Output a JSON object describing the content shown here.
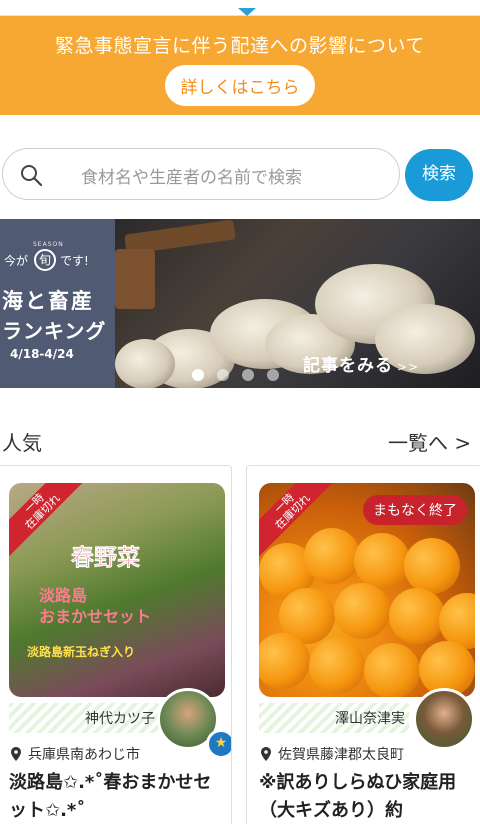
{
  "notice": {
    "message": "緊急事態宣言に伴う配達への影響について",
    "link_label": "詳しくはこちら",
    "bg_color": "#f7a833"
  },
  "search": {
    "placeholder": "食材名や生産者の名前で検索",
    "button_label": "検索",
    "icon": "search-icon",
    "button_color": "#1a9ad6"
  },
  "banner": {
    "season_small": "SEASON",
    "now_prefix": "今が",
    "shun": "旬",
    "now_suffix": "です!",
    "title_line1": "海と畜産",
    "title_line2": "ランキング",
    "date_range": "4/18-4/24",
    "cta_label": "記事をみる",
    "cta_arrows": ">>",
    "dots_total": 4,
    "active_dot": 1
  },
  "section": {
    "title": "人気",
    "more_label": "一覧へ >"
  },
  "products": [
    {
      "ribbon": "一時\n在庫切れ",
      "image_text_1": "春野菜",
      "image_text_2": "淡路島\nおまかせセット",
      "image_text_3": "淡路島新玉ねぎ入り",
      "producer": "神代カツ子",
      "location": "兵庫県南あわじ市",
      "title": "淡路島✩.*˚春おまかせセット✩.*˚",
      "medal_icon": "star-medal-icon"
    },
    {
      "ribbon": "一時\n在庫切れ",
      "ending_badge": "まもなく終了",
      "producer": "澤山奈津実",
      "location": "佐賀県藤津郡太良町",
      "title": "※訳ありしらぬひ家庭用（大キズあり）約"
    }
  ]
}
